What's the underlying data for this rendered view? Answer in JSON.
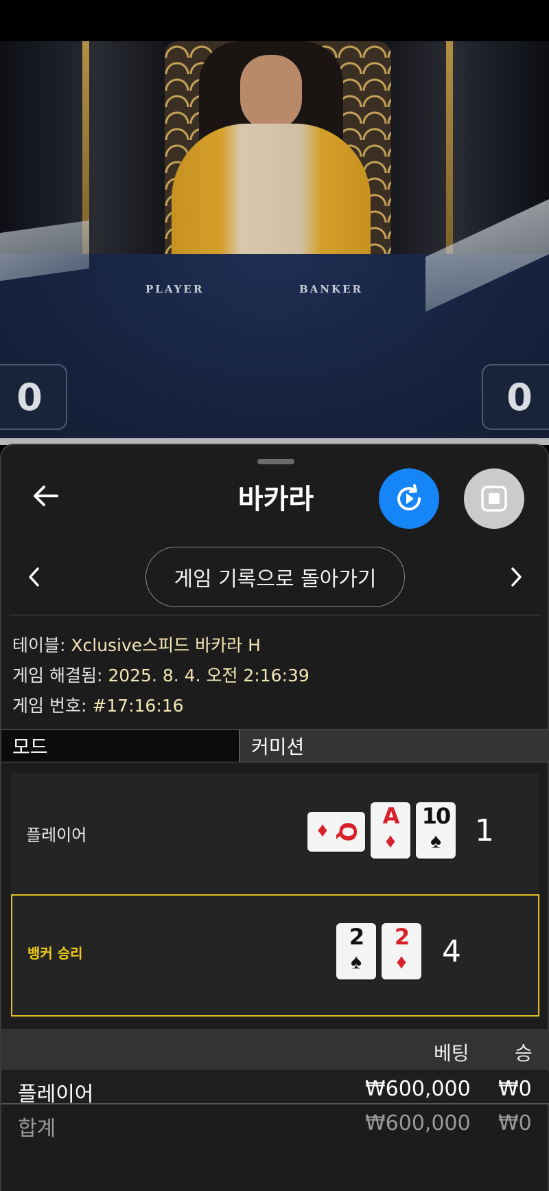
{
  "video": {
    "table_labels": [
      "PLAYER",
      "BANKER"
    ],
    "player_score": "0",
    "banker_score": "0"
  },
  "header": {
    "title": "바카라",
    "back_icon": "arrow-left-icon",
    "replay_icon": "replay-play-icon",
    "stop_icon": "stop-square-icon"
  },
  "nav": {
    "history_label": "게임 기록으로 돌아가기",
    "prev_icon": "chevron-left-icon",
    "next_icon": "chevron-right-icon"
  },
  "info": {
    "table_label": "테이블: ",
    "table_value": "Xclusive스피드 바카라 H",
    "resolved_label": "게임 해결됨: ",
    "resolved_value": "2025. 8. 4. 오전 2:16:39",
    "number_label": "게임 번호: ",
    "number_value": "#17:16:16"
  },
  "tabs": {
    "mode": "모드",
    "commission": "커미션"
  },
  "hands": {
    "player": {
      "label": "플레이어",
      "cards": [
        {
          "rank": "Q",
          "suit": "♦",
          "color": "red",
          "orientation": "sideways"
        },
        {
          "rank": "A",
          "suit": "♦",
          "color": "red",
          "orientation": "upright"
        },
        {
          "rank": "10",
          "suit": "♠",
          "color": "black",
          "orientation": "upright"
        }
      ],
      "score": "1"
    },
    "banker": {
      "label": "뱅커 승리",
      "cards": [
        {
          "rank": "2",
          "suit": "♠",
          "color": "black",
          "orientation": "upright"
        },
        {
          "rank": "2",
          "suit": "♦",
          "color": "red",
          "orientation": "upright"
        }
      ],
      "score": "4",
      "highlight_color": "#e0c020"
    }
  },
  "bets": {
    "headers": {
      "bet": "베팅",
      "win": "승"
    },
    "rows": [
      {
        "name": "플레이어",
        "bet": "₩600,000",
        "win": "₩0"
      }
    ],
    "total": {
      "name": "합계",
      "bet": "₩600,000",
      "win": "₩0"
    }
  },
  "colors": {
    "accent_blue": "#1685f8",
    "winner_yellow": "#e0c020",
    "info_value": "#f5e6b5"
  }
}
